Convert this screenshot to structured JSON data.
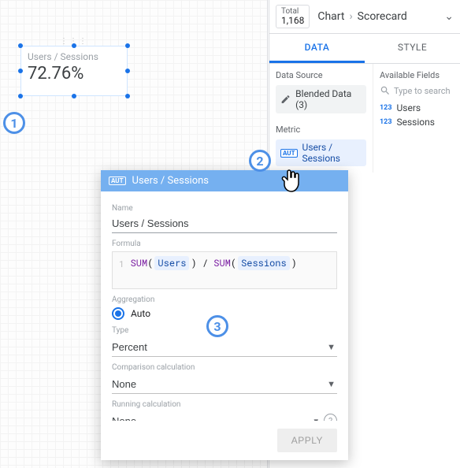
{
  "scorecard": {
    "title": "Users / Sessions",
    "value": "72.76%"
  },
  "right_panel": {
    "total_label": "Total",
    "total_value": "1,168",
    "breadcrumb_root": "Chart",
    "breadcrumb_current": "Scorecard",
    "tabs": {
      "data": "DATA",
      "style": "STYLE"
    },
    "data_source_label": "Data Source",
    "data_source_value": "Blended Data (3)",
    "metric_label": "Metric",
    "metric_badge": "AUT",
    "metric_value": "Users / Sessions",
    "available_fields_label": "Available Fields",
    "search_placeholder": "Type to search",
    "fields": [
      "Users",
      "Sessions"
    ]
  },
  "editor": {
    "header_badge": "AUT",
    "header_title": "Users / Sessions",
    "name_label": "Name",
    "name_value": "Users / Sessions",
    "formula_label": "Formula",
    "formula_line": "1",
    "formula_fn": "SUM",
    "formula_dim1": "Users",
    "formula_dim2": "Sessions",
    "aggregation_label": "Aggregation",
    "aggregation_value": "Auto",
    "type_label": "Type",
    "type_value": "Percent",
    "comparison_label": "Comparison calculation",
    "comparison_value": "None",
    "running_label": "Running calculation",
    "running_value": "None",
    "apply_label": "APPLY"
  },
  "annotations": {
    "one": "1",
    "two": "2",
    "three": "3"
  }
}
